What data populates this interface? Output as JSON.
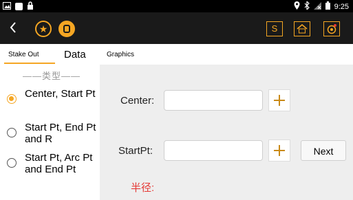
{
  "status_bar": {
    "time": "9:25",
    "left_icons": [
      "image-icon",
      "square-icon",
      "lock-icon"
    ],
    "right_icons": [
      "location-icon",
      "bluetooth-icon",
      "no-signal-icon",
      "battery-icon"
    ]
  },
  "toolbar": {
    "back_icon": "chevron-left-icon",
    "star_icon": "star-icon",
    "database_icon": "database-icon",
    "s_label": "S",
    "home_icon": "home-icon",
    "target_icon": "target-icon",
    "accent_color": "#f5a623"
  },
  "tabs": [
    {
      "label": "Stake Out",
      "active": true
    },
    {
      "label": "Data",
      "active": false
    },
    {
      "label": "Graphics",
      "active": false
    }
  ],
  "type_panel": {
    "title": "——类型——",
    "options": [
      {
        "label": "Center, Start Pt",
        "checked": true
      },
      {
        "label": "Start Pt, End Pt and R",
        "checked": false
      },
      {
        "label": "Start Pt, Arc Pt and End Pt",
        "checked": false
      }
    ]
  },
  "form": {
    "center_label": "Center:",
    "center_value": "",
    "startpt_label": "StartPt:",
    "startpt_value": "",
    "next_label": "Next",
    "radius_label": "半径:"
  }
}
